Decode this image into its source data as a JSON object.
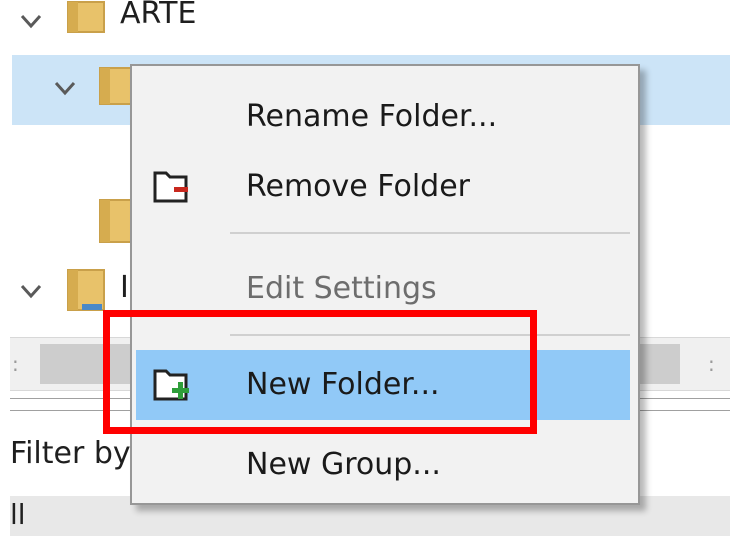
{
  "tree": {
    "items": [
      {
        "label": "ARTE"
      },
      {
        "label": ""
      },
      {
        "label": ""
      },
      {
        "label": "I"
      }
    ]
  },
  "filter": {
    "label": "Filter by"
  },
  "bottom": {
    "label": "ll"
  },
  "context_menu": {
    "items": [
      {
        "label": "Rename Folder...",
        "icon": "",
        "disabled": false
      },
      {
        "label": "Remove Folder",
        "icon": "remove-folder-icon",
        "disabled": false
      },
      {
        "label": "Edit Settings",
        "icon": "",
        "disabled": true
      },
      {
        "label": "New Folder...",
        "icon": "new-folder-icon",
        "disabled": false,
        "hovered": true
      },
      {
        "label": "New Group...",
        "icon": "",
        "disabled": false
      }
    ]
  },
  "colors": {
    "selection": "#cce4f7",
    "menu_hover": "#91c9f7",
    "annotation": "#ff0000",
    "folder": "#e8c26a"
  }
}
